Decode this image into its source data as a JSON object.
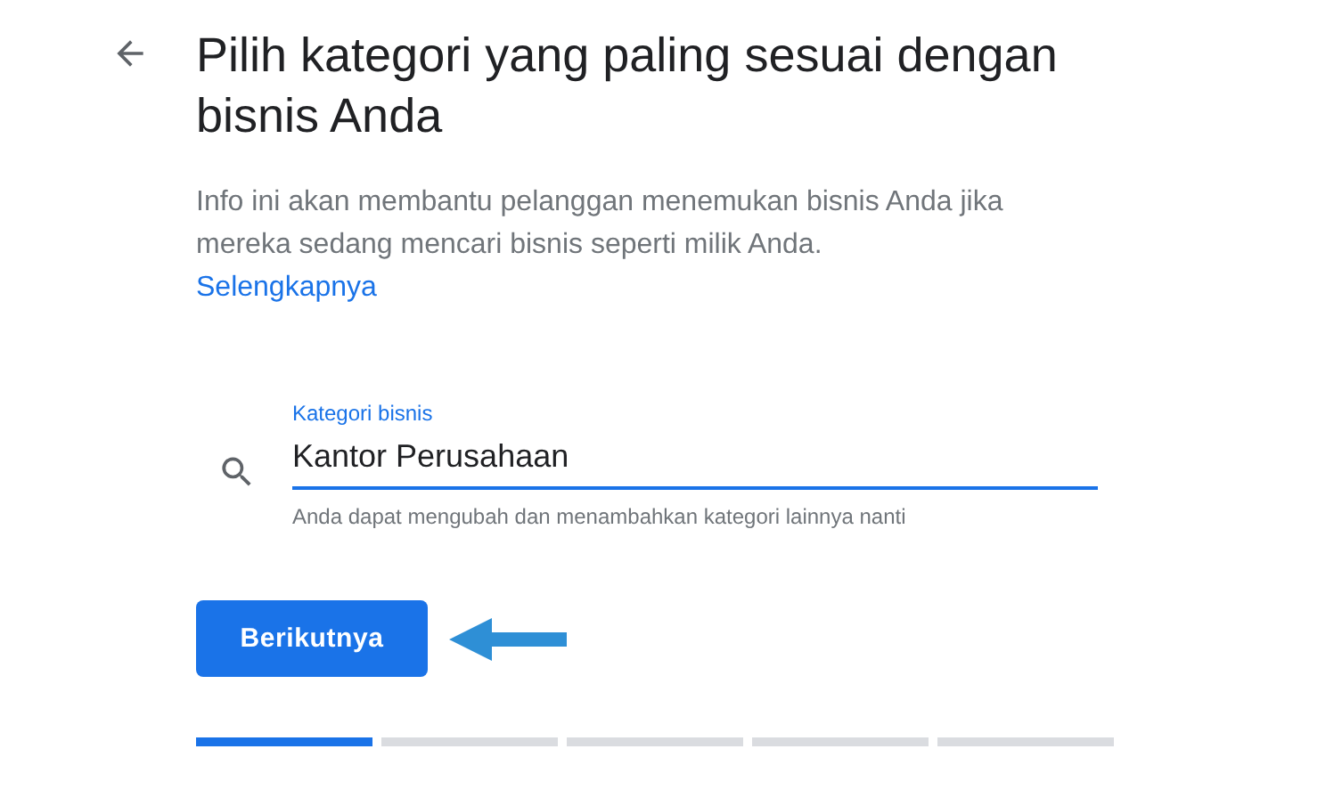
{
  "title": "Pilih kategori yang paling sesuai dengan bisnis Anda",
  "description": "Info ini akan membantu pelanggan menemukan bisnis Anda jika mereka sedang mencari bisnis seperti milik Anda.",
  "link": "Selengkapnya",
  "field": {
    "label": "Kategori bisnis",
    "value": "Kantor Perusahaan",
    "helper": "Anda dapat mengubah dan menambahkan kategori lainnya nanti"
  },
  "button": "Berikutnya",
  "progress_steps": [
    {
      "done": true
    },
    {
      "done": false
    },
    {
      "done": false
    },
    {
      "done": false
    },
    {
      "done": false
    }
  ]
}
